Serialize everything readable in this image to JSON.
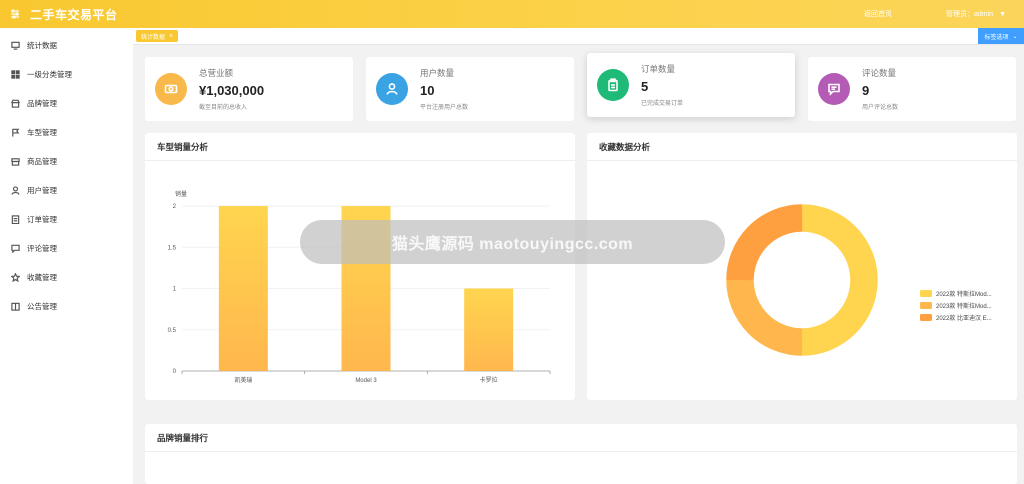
{
  "header": {
    "brand": "二手车交易平台",
    "home_link": "返回首页",
    "admin_label": "管理员：admin"
  },
  "sidebar": {
    "items": [
      {
        "label": "统计数据",
        "icon": "monitor-icon"
      },
      {
        "label": "一级分类管理",
        "icon": "grid-icon"
      },
      {
        "label": "品牌管理",
        "icon": "shop-icon"
      },
      {
        "label": "车型管理",
        "icon": "flag-icon"
      },
      {
        "label": "商品管理",
        "icon": "box-icon"
      },
      {
        "label": "用户管理",
        "icon": "user-icon"
      },
      {
        "label": "订单管理",
        "icon": "document-icon"
      },
      {
        "label": "评论管理",
        "icon": "comment-icon"
      },
      {
        "label": "收藏管理",
        "icon": "star-icon"
      },
      {
        "label": "公告管理",
        "icon": "notebook-icon"
      }
    ]
  },
  "tabs": {
    "active": "统计数据",
    "options_label": "标签选项"
  },
  "stats": [
    {
      "title": "总营业额",
      "value": "¥1,030,000",
      "sub": "截至目前的总收入",
      "color": "#f8b84a"
    },
    {
      "title": "用户数量",
      "value": "10",
      "sub": "平台注册用户总数",
      "color": "#3aa3e3"
    },
    {
      "title": "订单数量",
      "value": "5",
      "sub": "已完成交易订单",
      "color": "#1fb978"
    },
    {
      "title": "评论数量",
      "value": "9",
      "sub": "用户评论总数",
      "color": "#b45bb5"
    }
  ],
  "panels": {
    "sales_title": "车型销量分析",
    "favorites_title": "收藏数据分析",
    "brand_rank_title": "品牌销量排行"
  },
  "watermark": "猫头鹰源码 maotouyingcc.com",
  "chart_data": [
    {
      "type": "bar",
      "title": "",
      "ylabel": "销量",
      "categories": [
        "凯美瑞",
        "Model 3",
        "卡罗拉"
      ],
      "values": [
        2,
        2,
        1
      ],
      "ylim": [
        0,
        2
      ],
      "yticks": [
        "0",
        "0.5",
        "1",
        "1.5",
        "2"
      ],
      "grid": true,
      "colors": [
        "#ffd54f",
        "#ffb74d"
      ]
    },
    {
      "type": "pie",
      "donut": true,
      "categories": [
        "2022款 特斯拉Mod...",
        "2023款 特斯拉Mod...",
        "2022款 比亚迪汉 E..."
      ],
      "values": [
        50,
        25,
        25
      ],
      "colors": [
        "#ffd54f",
        "#ffb74d",
        "#ffa040"
      ],
      "legend": "right"
    }
  ]
}
